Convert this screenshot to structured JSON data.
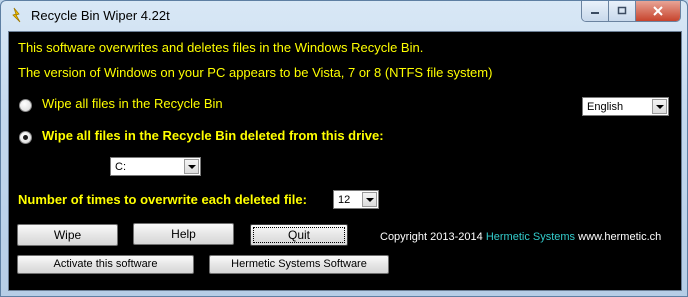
{
  "window": {
    "title": "Recycle Bin Wiper 4.22t"
  },
  "info": {
    "line1": "This software overwrites and deletes files in the Windows Recycle Bin.",
    "line2": "The version of Windows on your PC appears to be Vista, 7 or 8 (NTFS file system)"
  },
  "options": {
    "wipe_all_label": "Wipe all files in the Recycle Bin",
    "wipe_drive_label": "Wipe all files in the Recycle Bin deleted from this drive:",
    "selected": "wipe_drive"
  },
  "language": {
    "selected": "English"
  },
  "drive": {
    "selected": "C:"
  },
  "overwrite": {
    "label": "Number of times to overwrite each deleted file:",
    "selected": "12"
  },
  "buttons": {
    "wipe": "Wipe",
    "help": "Help",
    "quit": "Quit",
    "activate": "Activate this software",
    "hermetic_software": "Hermetic Systems Software"
  },
  "footer": {
    "copyright": "Copyright 2013-2014",
    "company": "Hermetic Systems",
    "website": "www.hermetic.ch"
  },
  "colors": {
    "text": "#ffff00",
    "background": "#000000",
    "company_link": "#33cccc"
  },
  "icons": [
    "recycle-bin-wiper-app-icon",
    "minimize-icon",
    "maximize-icon",
    "close-icon",
    "dropdown-arrow-icon"
  ]
}
